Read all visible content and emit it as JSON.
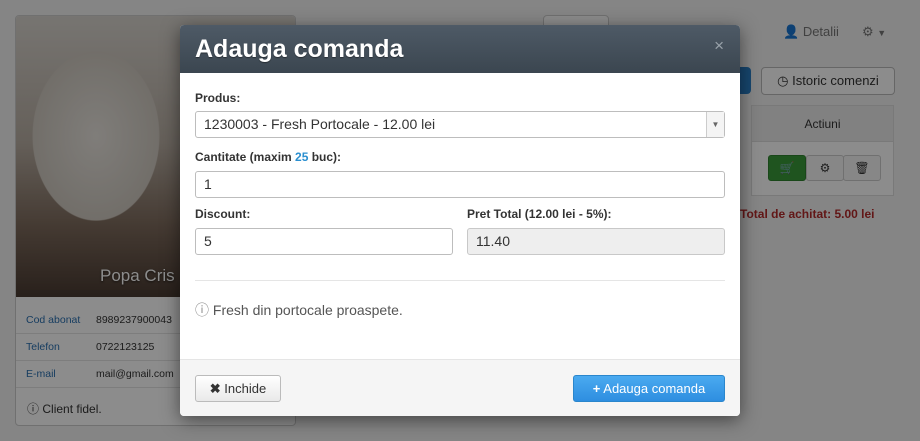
{
  "background": {
    "profile": {
      "name": "Popa Cris",
      "rows": [
        {
          "key": "Cod abonat",
          "value": "8989237900043"
        },
        {
          "key": "Telefon",
          "value": "0722123125"
        },
        {
          "key": "E-mail",
          "value": "mail@gmail.com"
        }
      ],
      "note": "Client fidel."
    },
    "details_label": "Detalii",
    "history_button": "Istoric comenzi",
    "actions_header": "Actiuni",
    "total_label": "Total de achitat: 5.00 lei"
  },
  "modal": {
    "title": "Adauga comanda",
    "close_glyph": "×",
    "product": {
      "label": "Produs:",
      "selected": "1230003 - Fresh Portocale - 12.00 lei"
    },
    "quantity": {
      "label_prefix": "Cantitate (maxim ",
      "max": "25",
      "label_suffix": " buc):",
      "value": "1"
    },
    "discount": {
      "label": "Discount:",
      "value": "5"
    },
    "total": {
      "label": "Pret Total (12.00 lei - 5%):",
      "value": "11.40"
    },
    "description": "Fresh din portocale proaspete.",
    "buttons": {
      "close": "Inchide",
      "add": "Adauga comanda"
    }
  },
  "colors": {
    "header": "#3b4650",
    "primary": "#2e8ee0",
    "link": "#2a8fd0",
    "danger": "#b22b2b",
    "success": "#3a9a3a"
  },
  "icons": [
    "user-icon",
    "gear-icon",
    "clock-icon",
    "cart-icon",
    "trash-icon",
    "info-icon",
    "times-icon",
    "plus-icon",
    "caret-down-icon"
  ]
}
